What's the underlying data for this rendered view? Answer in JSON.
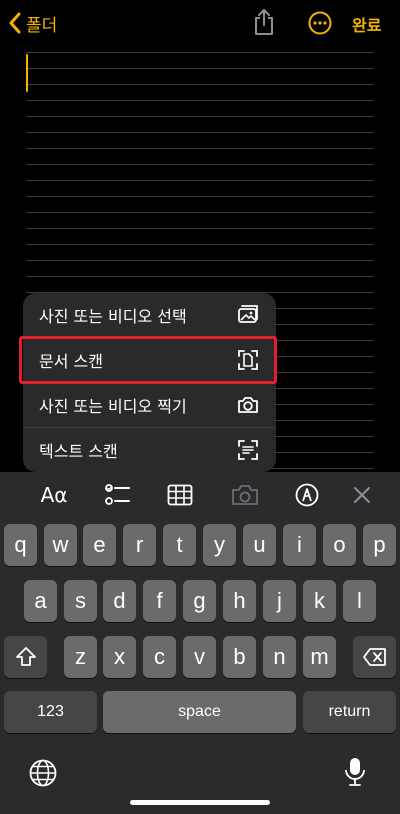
{
  "nav": {
    "back_label": "폴더",
    "done_label": "완료",
    "accent": "#f5b400"
  },
  "menu": {
    "items": [
      {
        "label": "사진 또는 비디오 선택",
        "icon": "photo-library-icon"
      },
      {
        "label": "문서 스캔",
        "icon": "document-scan-icon"
      },
      {
        "label": "사진 또는 비디오 찍기",
        "icon": "camera-icon"
      },
      {
        "label": "텍스트 스캔",
        "icon": "text-scan-icon"
      }
    ],
    "highlighted_item": "문서 스캔",
    "highlight_color": "#e0202a"
  },
  "keyboard": {
    "toolbar": {
      "format_label": "Aα",
      "icons": [
        "text-format-icon",
        "checklist-icon",
        "table-icon",
        "camera-icon",
        "markup-icon",
        "close-icon"
      ]
    },
    "row1": [
      "q",
      "w",
      "e",
      "r",
      "t",
      "y",
      "u",
      "i",
      "o",
      "p"
    ],
    "row2": [
      "a",
      "s",
      "d",
      "f",
      "g",
      "h",
      "j",
      "k",
      "l"
    ],
    "row3": [
      "z",
      "x",
      "c",
      "v",
      "b",
      "n",
      "m"
    ],
    "numbers_label": "123",
    "space_label": "space",
    "return_label": "return"
  }
}
